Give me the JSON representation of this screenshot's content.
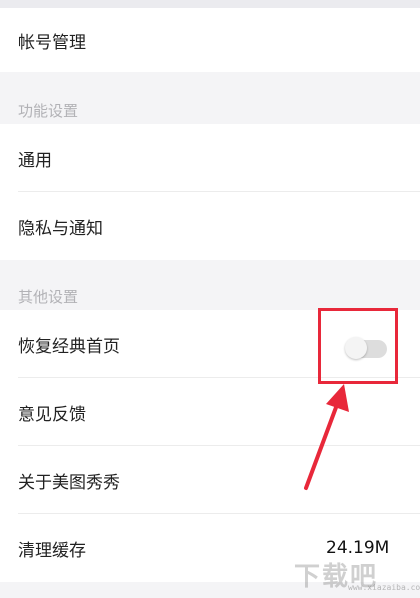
{
  "account": {
    "label": "帐号管理"
  },
  "sections": {
    "features": {
      "header": "功能设置",
      "items": [
        {
          "label": "通用"
        },
        {
          "label": "隐私与通知"
        }
      ]
    },
    "other": {
      "header": "其他设置",
      "items": [
        {
          "label": "恢复经典首页",
          "toggle_on": false
        },
        {
          "label": "意见反馈"
        },
        {
          "label": "关于美图秀秀"
        },
        {
          "label": "清理缓存",
          "value": "24.19M"
        }
      ]
    }
  },
  "watermark": {
    "text": "下载吧",
    "url": "www.xiazaiba.com"
  },
  "colors": {
    "annotation": "#e8283a",
    "toggle_track": "#dddddd",
    "background": "#f4f4f6"
  }
}
